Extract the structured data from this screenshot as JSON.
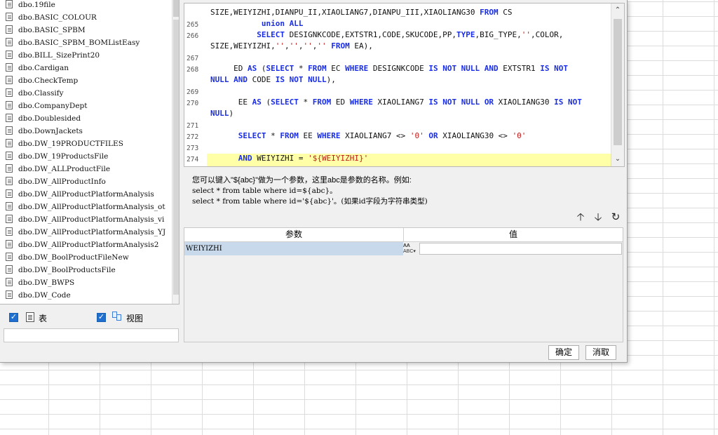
{
  "table_list": [
    "dbo.19file",
    "dbo.BASIC_COLOUR",
    "dbo.BASIC_SPBM",
    "dbo.BASIC_SPBM_BOMListEasy",
    "dbo.BILL_SizePrint20",
    "dbo.Cardigan",
    "dbo.CheckTemp",
    "dbo.Classify",
    "dbo.CompanyDept",
    "dbo.Doublesided",
    "dbo.DownJackets",
    "dbo.DW_19PRODUCTFILES",
    "dbo.DW_19ProductsFile",
    "dbo.DW_ALLProductFile",
    "dbo.DW_AllProductInfo",
    "dbo.DW_AllProductPlatformAnalysis",
    "dbo.DW_AllProductPlatformAnalysis_ot",
    "dbo.DW_AllProductPlatformAnalysis_vi",
    "dbo.DW_AllProductPlatformAnalysis_YJ",
    "dbo.DW_AllProductPlatformAnalysis2",
    "dbo.DW_BoolProductFileNew",
    "dbo.DW_BoolProductsFile",
    "dbo.DW_BWPS",
    "dbo.DW_Code"
  ],
  "filters": {
    "table_label": "表",
    "view_label": "视图",
    "table_checked": "✓",
    "view_checked": "✓"
  },
  "editor": {
    "line_numbers": [
      "265",
      "266",
      "267",
      "268",
      "269",
      "270",
      "271",
      "272",
      "273",
      "274"
    ]
  },
  "hint": {
    "line1": "您可以键入\"${abc}\"做为一个参数，这里abc是参数的名称。例如:",
    "line2": "select * from table where id=${abc}。",
    "line3": "select * from table where id='${abc}'。(如果id字段为字符串类型)"
  },
  "params": {
    "col_param": "参数",
    "col_value": "值",
    "rows": [
      {
        "name": "WEIYIZHI",
        "value": ""
      }
    ],
    "type_icon_text": "ABC"
  },
  "buttons": {
    "ok": "确定",
    "cancel": "消取"
  }
}
